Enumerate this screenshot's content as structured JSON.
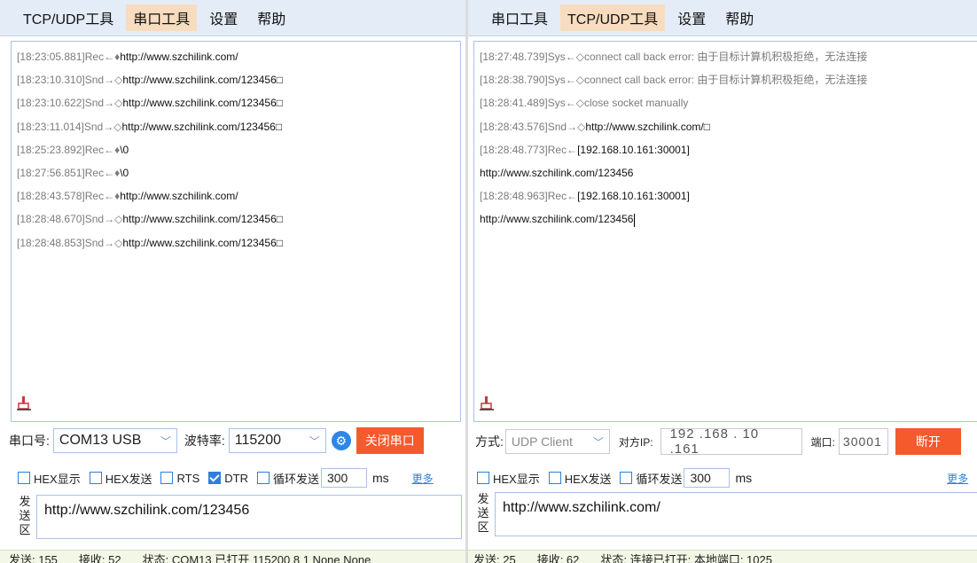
{
  "left": {
    "menu": [
      "TCP/UDP工具",
      "串口工具",
      "设置",
      "帮助"
    ],
    "log": [
      {
        "ts": "[18:23:05.881]",
        "dir": "Rec←♦",
        "msg": "http://www.szchilink.com/"
      },
      {
        "ts": "[18:23:10.310]",
        "dir": "Snd→◇",
        "msg": "http://www.szchilink.com/123456□"
      },
      {
        "ts": "[18:23:10.622]",
        "dir": "Snd→◇",
        "msg": "http://www.szchilink.com/123456□"
      },
      {
        "ts": "[18:23:11.014]",
        "dir": "Snd→◇",
        "msg": "http://www.szchilink.com/123456□"
      },
      {
        "ts": "[18:25:23.892]",
        "dir": "Rec←♦",
        "msg": "\\0"
      },
      {
        "ts": "[18:27:56.851]",
        "dir": "Rec←♦",
        "msg": "\\0"
      },
      {
        "ts": "[18:28:43.578]",
        "dir": "Rec←♦",
        "msg": "http://www.szchilink.com/"
      },
      {
        "ts": "[18:28:48.670]",
        "dir": "Snd→◇",
        "msg": "http://www.szchilink.com/123456□"
      },
      {
        "ts": "[18:28:48.853]",
        "dir": "Snd→◇",
        "msg": "http://www.szchilink.com/123456□"
      }
    ],
    "port_label": "串口号:",
    "port_value": "COM13 USB",
    "baud_label": "波特率:",
    "baud_value": "115200",
    "close_port_label": "关闭串口",
    "options": {
      "hex_display": "HEX显示",
      "hex_send": "HEX发送",
      "rts": "RTS",
      "dtr": "DTR",
      "loop_send": "循环发送",
      "interval": "300",
      "ms": "ms",
      "more": "更多"
    },
    "send_label": [
      "发",
      "送",
      "区"
    ],
    "send_text": "http://www.szchilink.com/123456",
    "status": {
      "sent": "发送: 155",
      "recv": "接收: 52",
      "state": "状态: COM13 已打开 115200 8 1 None None"
    }
  },
  "right": {
    "menu": [
      "串口工具",
      "TCP/UDP工具",
      "设置",
      "帮助"
    ],
    "log": [
      {
        "ts": "[18:27:48.739]Sys←◇connect call back error: 由于目标计算机积极拒绝，无法连接",
        "msg": ""
      },
      {
        "ts": "[18:28:38.790]Sys←◇connect call back error: 由于目标计算机积极拒绝，无法连接",
        "msg": ""
      },
      {
        "ts": "[18:28:41.489]Sys←◇close socket manually",
        "msg": ""
      },
      {
        "ts": "[18:28:43.576]Snd→◇",
        "msg": "http://www.szchilink.com/□"
      },
      {
        "ts": "[18:28:48.773]Rec←",
        "msg": "[192.168.10.161:30001]"
      },
      {
        "ts": "",
        "msg": "http://www.szchilink.com/123456"
      },
      {
        "ts": "[18:28:48.963]Rec←",
        "msg": "[192.168.10.161:30001]"
      },
      {
        "ts": "",
        "msg": "http://www.szchilink.com/123456"
      }
    ],
    "mode_label": "方式:",
    "mode_value": "UDP Client",
    "peer_ip_label": "对方IP:",
    "peer_ip": "192 .168 . 10 .161",
    "port_label": "端口:",
    "port_value": "30001",
    "disconnect_label": "断开",
    "options": {
      "hex_display": "HEX显示",
      "hex_send": "HEX发送",
      "loop_send": "循环发送",
      "interval": "300",
      "ms": "ms",
      "more": "更多"
    },
    "send_label": [
      "发",
      "送",
      "区"
    ],
    "send_text": "http://www.szchilink.com/",
    "status": {
      "sent": "发送: 25",
      "recv": "接收: 62",
      "state": "状态: 连接已打开: 本地端口: 1025"
    }
  },
  "colors": {
    "menubar_bg": "#e4ecf7",
    "active_tab": "#f8dcbf",
    "accent": "#2e7fd8",
    "close_button": "#f55a2c"
  },
  "icons": {
    "clear": "broom-icon",
    "settings": "gear-icon",
    "dropdown": "chevron-down-icon"
  }
}
